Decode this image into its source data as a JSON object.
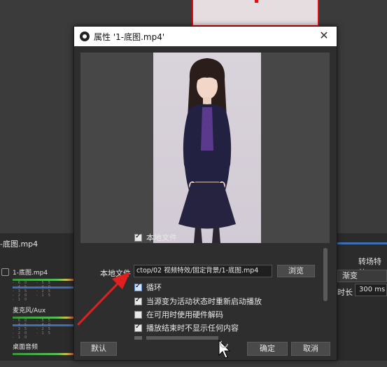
{
  "background": {
    "scene_title": "-底图.mp4",
    "mixer": {
      "tracks": [
        {
          "name": "1-底图.mp4"
        },
        {
          "name": "麦克风/Aux"
        },
        {
          "name": "桌面音频"
        }
      ],
      "scale": "-60 -55 -45 -40 -35 -25 -20 -15 -10"
    },
    "transitions": {
      "title": "转场特效",
      "selected": "渐变",
      "duration_label": "时长",
      "duration_value": "300 ms"
    }
  },
  "dialog": {
    "title": "属性 '1-底图.mp4'",
    "close_glyph": "✕",
    "properties": {
      "local_file_checkbox": {
        "label": "本地文件",
        "checked": true
      },
      "local_file_label": "本地文件",
      "local_file_path": "ctop/02 视频特效/固定背景/1-底图.mp4",
      "browse_label": "浏览",
      "loop": {
        "label": "循环",
        "checked": true
      },
      "restart_on_active": {
        "label": "当源变为活动状态时重新启动播放",
        "checked": true
      },
      "hw_decode": {
        "label": "在可用时使用硬件解码",
        "checked": false
      },
      "hide_on_end": {
        "label": "播放结束时不显示任何内容",
        "checked": true
      }
    },
    "buttons": {
      "defaults": "默认",
      "ok": "确定",
      "cancel": "取消"
    }
  },
  "colors": {
    "accent_blue": "#3f6fb5",
    "annotation_red": "#e02020",
    "selection_red": "#d11111"
  }
}
